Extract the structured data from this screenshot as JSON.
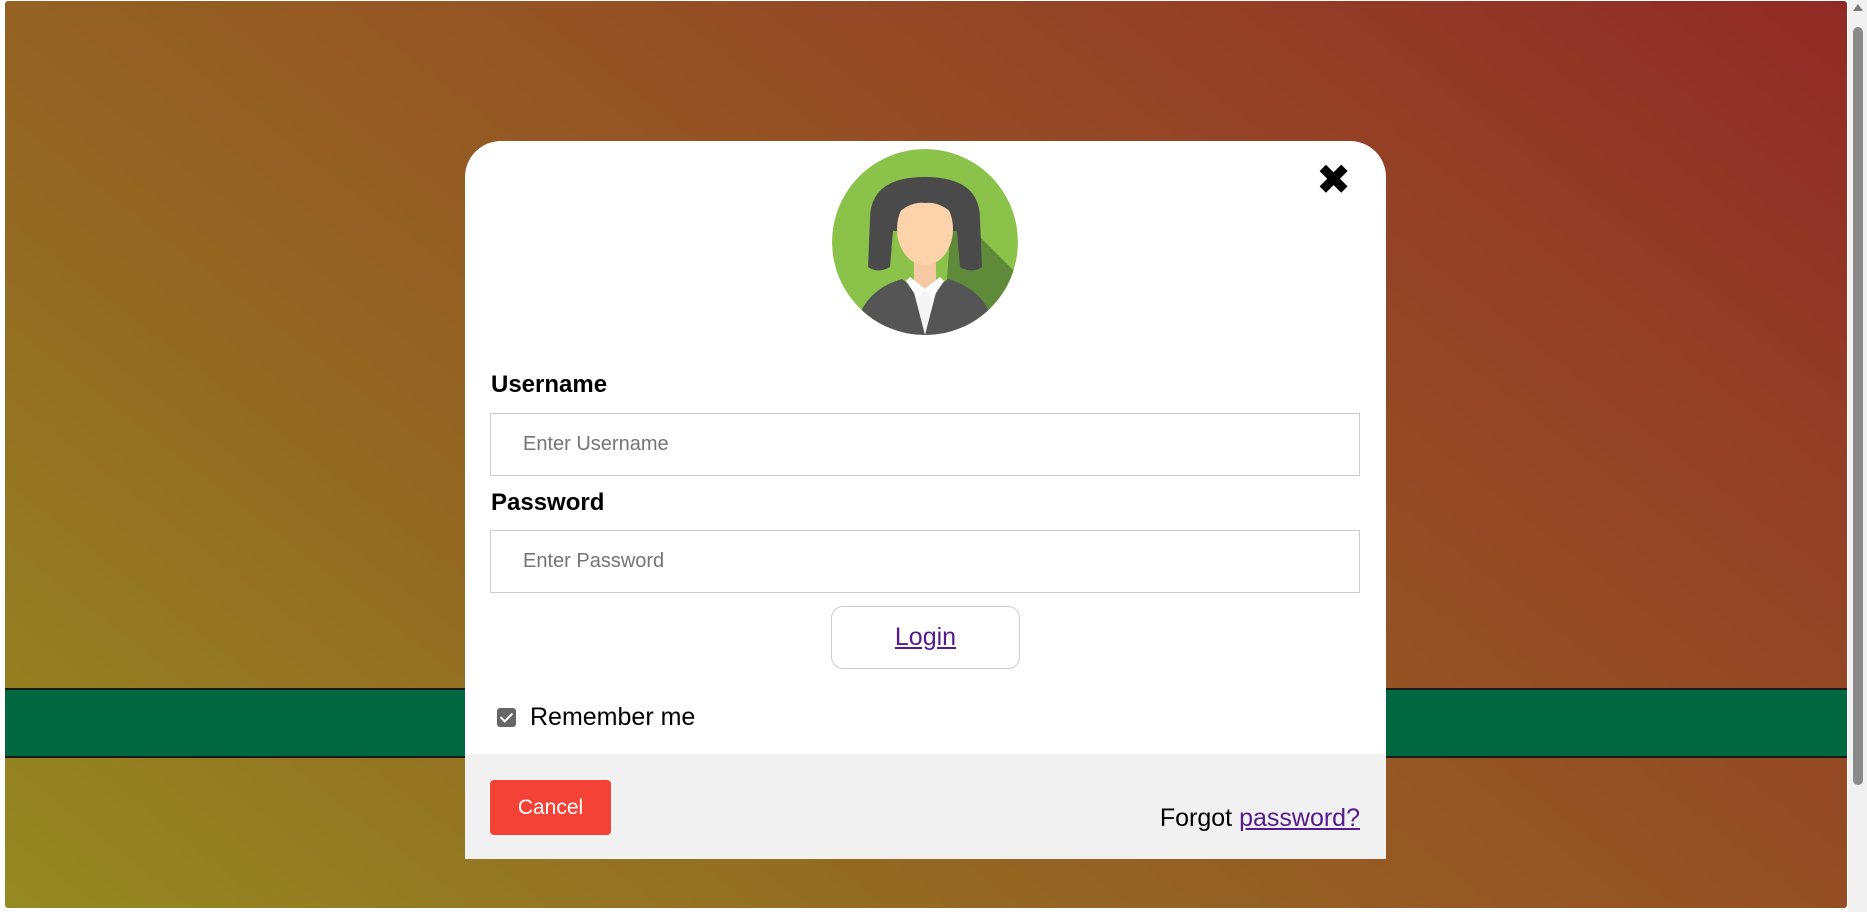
{
  "colors": {
    "background_gradient_start": "#958a21",
    "background_gradient_end": "#912a25",
    "green_bar": "#006840",
    "cancel_button": "#f44336",
    "link": "#551a8b",
    "footer": "#f1f1f1"
  },
  "modal": {
    "close_icon": "close-icon",
    "avatar_icon": "female-user-avatar",
    "username_label": "Username",
    "username_placeholder": "Enter Username",
    "username_value": "",
    "password_label": "Password",
    "password_placeholder": "Enter Password",
    "password_value": "",
    "login_label": "Login",
    "remember_checked": true,
    "remember_label": "Remember me",
    "cancel_label": "Cancel",
    "forgot_prefix": "Forgot",
    "forgot_link": "password?"
  }
}
